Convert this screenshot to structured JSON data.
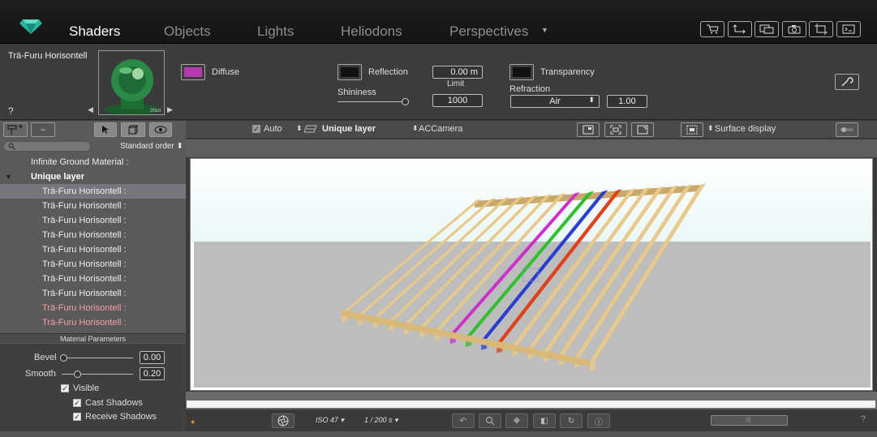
{
  "nav": {
    "tabs": [
      "Shaders",
      "Objects",
      "Lights",
      "Heliodons",
      "Perspectives"
    ],
    "active": "Shaders",
    "toolbar_icons": [
      "cart-icon",
      "export-icon",
      "windows-icon",
      "camera-icon",
      "crop-icon",
      "console-icon"
    ]
  },
  "editor": {
    "material_name": "Trä-Furu Horisontell",
    "help": "?",
    "preview_caption": "20cd",
    "diffuse_label": "Diffuse",
    "diffuse_color": "#b63bb0",
    "reflection_label": "Reflection",
    "reflection_color": "#111111",
    "limit_value": "0.00 m",
    "limit_label": "Limit",
    "shininess_label": "Shininess",
    "shininess_value": "1000",
    "shininess_fraction": 0.97,
    "transparency_label": "Transparency",
    "transparency_color": "#111111",
    "refraction_label": "Refraction",
    "refraction_select": "Air",
    "refraction_value": "1.00"
  },
  "left": {
    "sort": "Standard order",
    "tree": [
      {
        "label": "Infinite Ground Material :",
        "kind": "item"
      },
      {
        "label": "Unique layer",
        "kind": "group"
      },
      {
        "label": "Trä-Furu Horisontell :",
        "kind": "child",
        "selected": true
      },
      {
        "label": "Trä-Furu Horisontell :",
        "kind": "child"
      },
      {
        "label": "Trä-Furu Horisontell :",
        "kind": "child"
      },
      {
        "label": "Trä-Furu Horisontell :",
        "kind": "child"
      },
      {
        "label": "Trä-Furu Horisontell :",
        "kind": "child"
      },
      {
        "label": "Trä-Furu Horisontell :",
        "kind": "child"
      },
      {
        "label": "Trä-Furu Horisontell :",
        "kind": "child"
      },
      {
        "label": "Trä-Furu Horisontell :",
        "kind": "child"
      },
      {
        "label": "Trä-Furu Horisontell :",
        "kind": "child",
        "highlight": true
      },
      {
        "label": "Trä-Furu Horisontell :",
        "kind": "child",
        "highlight": true
      }
    ],
    "params_title": "Material Parameters",
    "bevel_label": "Bevel",
    "bevel_value": "0.00",
    "smooth_label": "Smooth",
    "smooth_value": "0.20",
    "visible_label": "Visible",
    "cast_label": "Cast Shadows",
    "receive_label": "Receive Shadows"
  },
  "viewbar": {
    "auto_label": "Auto",
    "layer_label": "Unique layer",
    "camera_label": "ACCamera",
    "display_label": "Surface display"
  },
  "bottom": {
    "iso": "ISO 47",
    "shutter": "1 / 200 s",
    "help": "?"
  },
  "scene": {
    "wood_color": "#e9c98a",
    "colored_bars": [
      "#cc2fcc",
      "#2fbf2f",
      "#2a3fd0",
      "#e0401a"
    ]
  }
}
